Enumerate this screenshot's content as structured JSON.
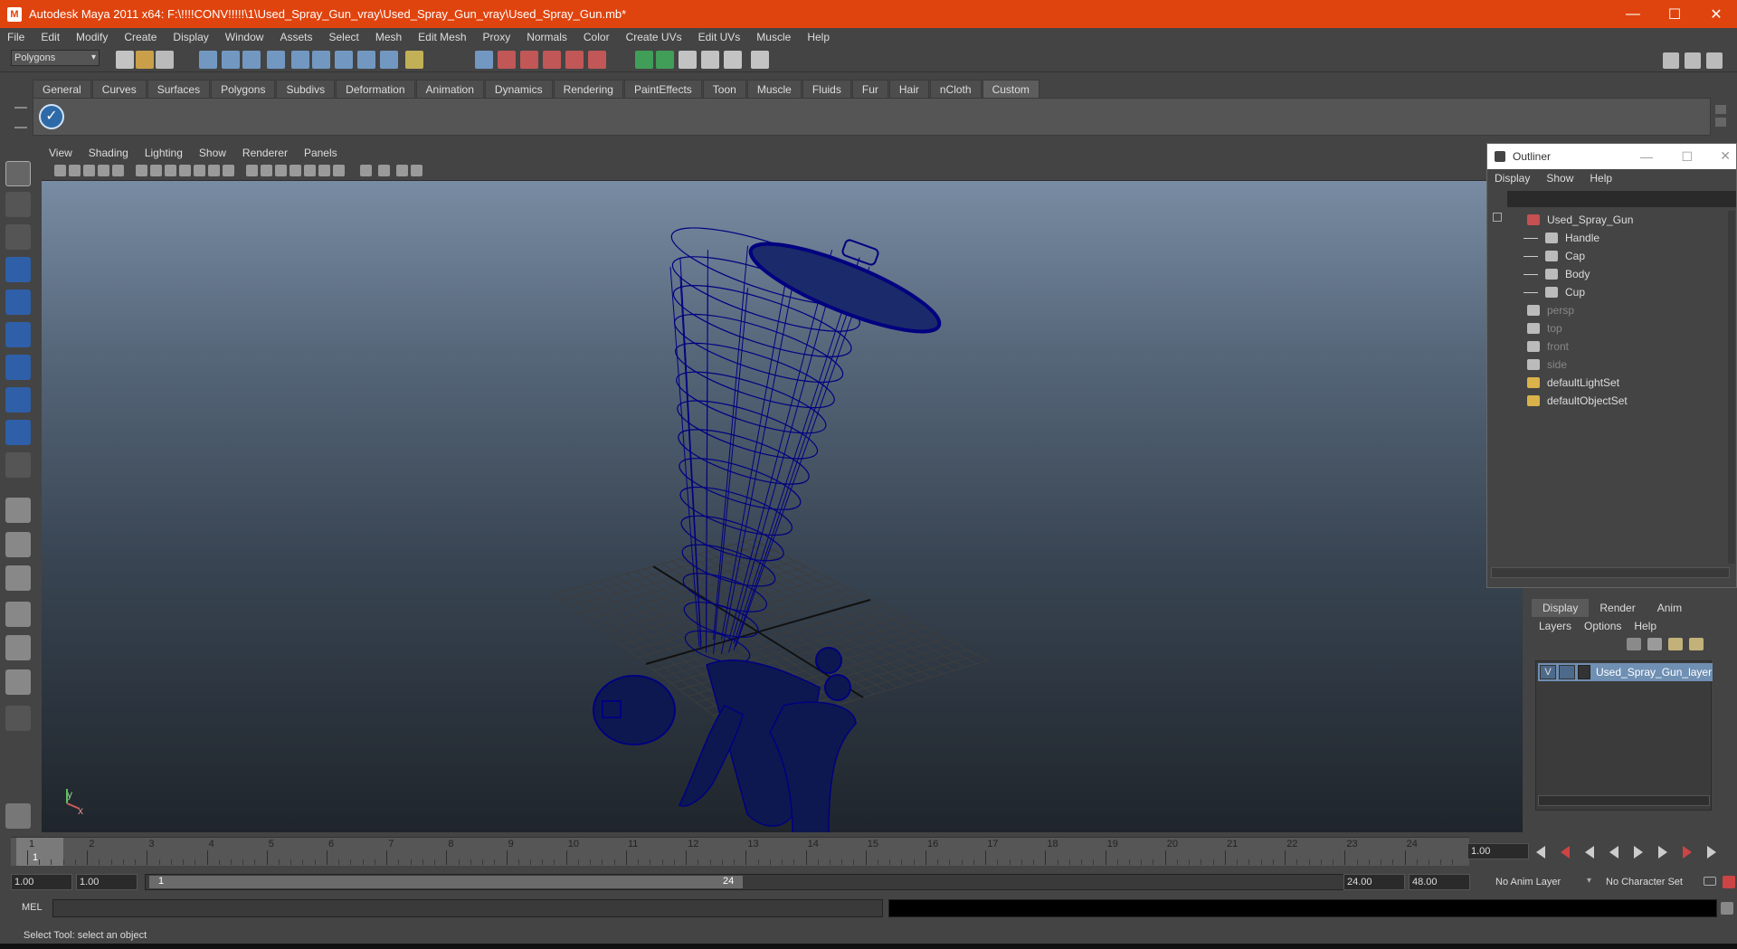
{
  "window": {
    "title": "Autodesk Maya 2011 x64: F:\\!!!!CONV!!!!!\\1\\Used_Spray_Gun_vray\\Used_Spray_Gun_vray\\Used_Spray_Gun.mb*",
    "app_icon": "M",
    "minimize": "—",
    "maximize": "☐",
    "close": "✕"
  },
  "menubar": [
    "File",
    "Edit",
    "Modify",
    "Create",
    "Display",
    "Window",
    "Assets",
    "Select",
    "Mesh",
    "Edit Mesh",
    "Proxy",
    "Normals",
    "Color",
    "Create UVs",
    "Edit UVs",
    "Muscle",
    "Help"
  ],
  "statusline": {
    "mode": "Polygons"
  },
  "shelf": {
    "tabs": [
      "General",
      "Curves",
      "Surfaces",
      "Polygons",
      "Subdivs",
      "Deformation",
      "Animation",
      "Dynamics",
      "Rendering",
      "PaintEffects",
      "Toon",
      "Muscle",
      "Fluids",
      "Fur",
      "Hair",
      "nCloth",
      "Custom"
    ],
    "active_tab": "Custom"
  },
  "viewport": {
    "menu": [
      "View",
      "Shading",
      "Lighting",
      "Show",
      "Renderer",
      "Panels"
    ],
    "axis_y": "y",
    "axis_x": "x",
    "wire_color": "#000080"
  },
  "outliner": {
    "title": "Outliner",
    "menu": [
      "Display",
      "Show",
      "Help"
    ],
    "items": [
      {
        "label": "Used_Spray_Gun",
        "indent": 0,
        "dim": false
      },
      {
        "label": "Handle",
        "indent": 1,
        "dim": false
      },
      {
        "label": "Cap",
        "indent": 1,
        "dim": false
      },
      {
        "label": "Body",
        "indent": 1,
        "dim": false
      },
      {
        "label": "Cup",
        "indent": 1,
        "dim": false
      },
      {
        "label": "persp",
        "indent": 0,
        "dim": true
      },
      {
        "label": "top",
        "indent": 0,
        "dim": true
      },
      {
        "label": "front",
        "indent": 0,
        "dim": true
      },
      {
        "label": "side",
        "indent": 0,
        "dim": true
      },
      {
        "label": "defaultLightSet",
        "indent": 0,
        "dim": false
      },
      {
        "label": "defaultObjectSet",
        "indent": 0,
        "dim": false
      }
    ]
  },
  "layers": {
    "tabs": [
      "Display",
      "Render",
      "Anim"
    ],
    "menu": [
      "Layers",
      "Options",
      "Help"
    ],
    "layer_visible": "V",
    "layer_name": "Used_Spray_Gun_layer"
  },
  "timeline": {
    "ticks": [
      "1",
      "2",
      "3",
      "4",
      "5",
      "6",
      "7",
      "8",
      "9",
      "10",
      "11",
      "12",
      "13",
      "14",
      "15",
      "16",
      "17",
      "18",
      "19",
      "20",
      "21",
      "22",
      "23",
      "24"
    ],
    "current_frame": "1",
    "current_time": "1.00"
  },
  "range": {
    "start": "1.00",
    "playback_start": "1.00",
    "slider_start": "1",
    "slider_end": "24",
    "playback_end": "24.00",
    "end": "48.00",
    "anim_layer": "No Anim Layer",
    "char_set": "No Character Set"
  },
  "cmd": {
    "label": "MEL"
  },
  "help": {
    "text": "Select Tool: select an object"
  }
}
